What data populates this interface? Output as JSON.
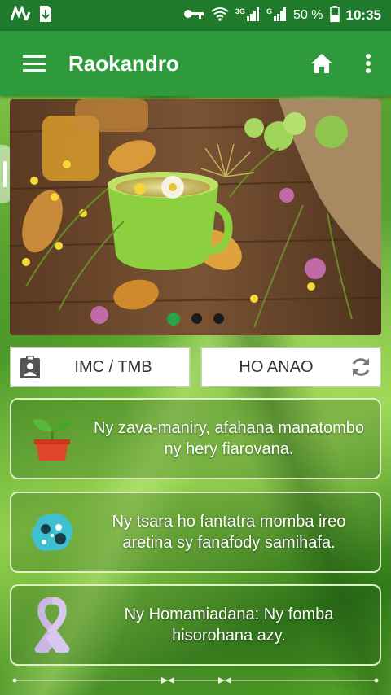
{
  "statusbar": {
    "network_3g": "3G",
    "network_g": "G",
    "battery": "50 %",
    "time": "10:35"
  },
  "appbar": {
    "title": "Raokandro",
    "icons": [
      "menu-icon",
      "home-icon",
      "more-vert-icon"
    ]
  },
  "carousel": {
    "image": "herbal tea cup with wildflowers on wooden table",
    "page_count": 3,
    "active_index": 0
  },
  "actions": {
    "imc_label": "IMC / TMB",
    "ho_anao_label": "HO ANAO"
  },
  "cards": [
    {
      "icon": "potted-plant-icon",
      "text": "Ny zava-maniry, afahana manatombo ny hery fiarovana."
    },
    {
      "icon": "virus-cell-icon",
      "text": "Ny tsara ho fantatra momba ireo aretina sy fanafody samihafa."
    },
    {
      "icon": "awareness-ribbon-icon",
      "text": "Ny Homamiadana: Ny fomba hisorohana azy."
    }
  ],
  "colors": {
    "statusbar": "#1f7a2c",
    "appbar": "#2f9a3c",
    "dot_active": "#29a34a",
    "card_border": "#dff1c4"
  }
}
